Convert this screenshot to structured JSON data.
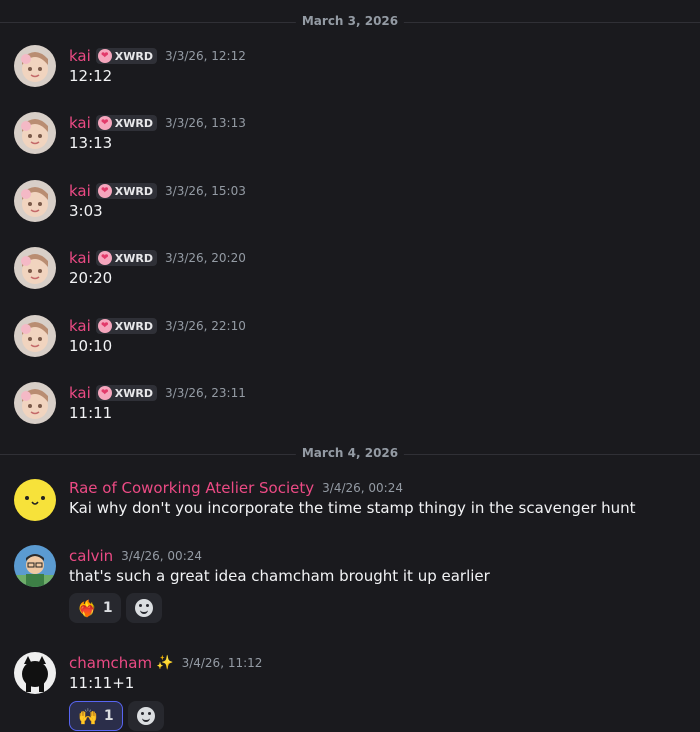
{
  "dividers": [
    {
      "label": "March 3, 2026"
    },
    {
      "label": "March 4, 2026"
    }
  ],
  "messages": [
    {
      "author": "kai",
      "tag": "XWRD",
      "time": "3/3/26, 12:12",
      "text": "12:12"
    },
    {
      "author": "kai",
      "tag": "XWRD",
      "time": "3/3/26, 13:13",
      "text": "13:13"
    },
    {
      "author": "kai",
      "tag": "XWRD",
      "time": "3/3/26, 15:03",
      "text": "3:03"
    },
    {
      "author": "kai",
      "tag": "XWRD",
      "time": "3/3/26, 20:20",
      "text": "20:20"
    },
    {
      "author": "kai",
      "tag": "XWRD",
      "time": "3/3/26, 22:10",
      "text": "10:10"
    },
    {
      "author": "kai",
      "tag": "XWRD",
      "time": "3/3/26, 23:11",
      "text": "11:11"
    },
    {
      "author": "Rae of Coworking Atelier Society",
      "time": "3/4/26, 00:24",
      "text": "Kai why don't you incorporate the time stamp thingy in the scavenger hunt"
    },
    {
      "author": "calvin",
      "time": "3/4/26, 00:24",
      "text": "that's such a great idea chamcham brought it up earlier",
      "reactions": [
        {
          "emoji": "❤️‍🔥",
          "count": "1"
        }
      ]
    },
    {
      "author": "chamcham",
      "time": "3/4/26, 11:12",
      "text": "11:11+1",
      "reactions": [
        {
          "emoji": "🙌",
          "count": "1"
        }
      ]
    }
  ],
  "colors": {
    "background": "#1a1a1e",
    "author": "#eb4a84",
    "timestamp": "#949ba4",
    "active_reaction_border": "#5865f2"
  },
  "icons": {
    "tag": "heart-icon",
    "add_reaction": "add-reaction-icon",
    "author_badge": "sparkle-icon"
  }
}
